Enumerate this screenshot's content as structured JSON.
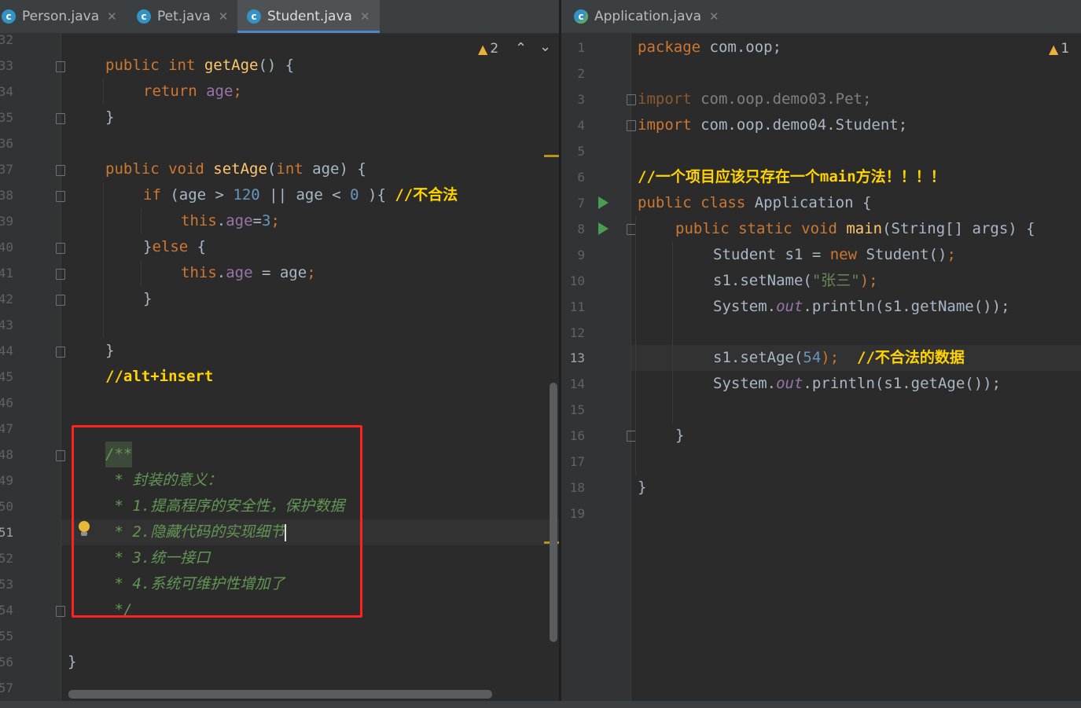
{
  "left_editor": {
    "tabs": [
      {
        "label": "Person.java",
        "icon": "java-class-icon",
        "active": false
      },
      {
        "label": "Pet.java",
        "icon": "java-class-icon",
        "active": false
      },
      {
        "label": "Student.java",
        "icon": "java-class-icon",
        "active": true
      }
    ],
    "warning_count": "2",
    "line_numbers": [
      "32",
      "33",
      "34",
      "35",
      "36",
      "37",
      "38",
      "39",
      "40",
      "41",
      "42",
      "43",
      "44",
      "45",
      "46",
      "47",
      "48",
      "49",
      "50",
      "51",
      "52",
      "53",
      "54",
      "55",
      "56",
      "57"
    ],
    "current_line": "51",
    "code": {
      "l33": "public int getAge() {",
      "l34": "return age;",
      "l35": "}",
      "l37": "public void setAge(int age) {",
      "l38_a": "if (age > ",
      "l38_num1": "120",
      "l38_b": " || age < ",
      "l38_num2": "0",
      "l38_c": " ){ ",
      "l38_comment": "//不合法",
      "l39": "this.age=3;",
      "l40": "}else {",
      "l41": "this.age = age;",
      "l42": "}",
      "l44": "}",
      "l45_comment": "//alt+insert",
      "l48_doc": "/**",
      "l49_doc": " * 封装的意义：",
      "l50_doc": " * 1.提高程序的安全性，保护数据",
      "l51_doc": " * 2.隐藏代码的实现细节",
      "l52_doc": " * 3.统一接口",
      "l53_doc": " * 4.系统可维护性增加了",
      "l54_doc": " */",
      "l56": "}"
    }
  },
  "right_editor": {
    "tabs": [
      {
        "label": "Application.java",
        "icon": "java-runnable-class-icon",
        "active": false
      }
    ],
    "warning_count": "1",
    "line_numbers": [
      "1",
      "2",
      "3",
      "4",
      "5",
      "6",
      "7",
      "8",
      "9",
      "10",
      "11",
      "12",
      "13",
      "14",
      "15",
      "16",
      "17",
      "18",
      "19"
    ],
    "current_line": "13",
    "code": {
      "l1_kw": "package",
      "l1_rest": " com.oop;",
      "l3_kw": "import",
      "l3_rest": " com.oop.demo03.Pet;",
      "l4_kw": "import",
      "l4_rest": " com.oop.demo04.Student;",
      "l6_comment": "//一个项目应该只存在一个main方法！！！！",
      "l7": "public class Application {",
      "l8": "public static void main(String[] args) {",
      "l9": "Student s1 = new Student();",
      "l10_a": "s1.setName(",
      "l10_str": "\"张三\"",
      "l10_b": ");",
      "l11_a": "System.",
      "l11_out": "out",
      "l11_b": ".println(s1.getName());",
      "l13_a": "s1.setAge(",
      "l13_num": "54",
      "l13_b": ");  ",
      "l13_comment": "//不合法的数据",
      "l14_a": "System.",
      "l14_out": "out",
      "l14_b": ".println(s1.getAge());",
      "l16": "}",
      "l18": "}"
    }
  }
}
